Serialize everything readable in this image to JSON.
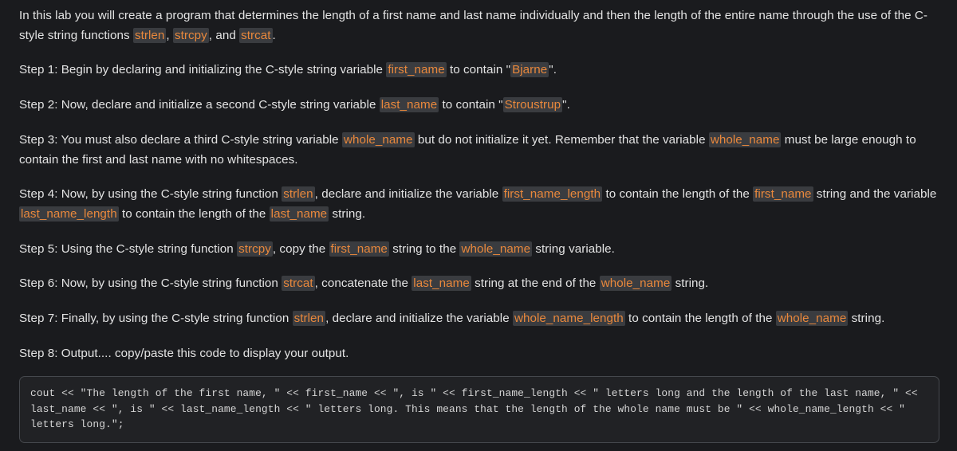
{
  "theme": {
    "background": "#1a1b1e",
    "text_color": "#e3e3e3",
    "inline_code_color": "#e9883c",
    "inline_code_background": "#3a3c40",
    "code_block_background": "#212225",
    "code_block_border": "#45484d",
    "code_block_text": "#d6d6d6"
  },
  "intro": {
    "t1": "In this lab you will create a program that determines the length of a first name and last name individually and then the length of the entire name through the use of the C-style string functions ",
    "c1": "strlen",
    "t2": ", ",
    "c2": "strcpy",
    "t3": ", and ",
    "c3": "strcat",
    "t4": "."
  },
  "step1": {
    "t1": "Step 1: Begin by declaring and initializing the C-style string variable ",
    "c1": "first_name",
    "t2": " to contain \"",
    "c2": "Bjarne",
    "t3": "\"."
  },
  "step2": {
    "t1": "Step 2: Now, declare and initialize a second C-style string variable ",
    "c1": "last_name",
    "t2": " to contain \"",
    "c2": "Stroustrup",
    "t3": "\"."
  },
  "step3": {
    "t1": "Step 3: You must also declare a third C-style string variable ",
    "c1": "whole_name",
    "t2": " but do not initialize it yet. Remember that the variable ",
    "c2": "whole_name",
    "t3": " must be large enough to contain the first and last name with no whitespaces."
  },
  "step4": {
    "t1": "Step 4: Now, by using the C-style string function ",
    "c1": "strlen",
    "t2": ", declare and initialize the variable ",
    "c2": "first_name_length",
    "t3": " to contain the length of the ",
    "c3": "first_name",
    "t4": " string and the variable ",
    "c4": "last_name_length",
    "t5": " to contain the length of the ",
    "c5": "last_name",
    "t6": " string."
  },
  "step5": {
    "t1": "Step 5: Using the C-style string function ",
    "c1": "strcpy",
    "t2": ", copy the ",
    "c2": "first_name",
    "t3": " string to the ",
    "c3": "whole_name",
    "t4": " string variable."
  },
  "step6": {
    "t1": "Step 6: Now, by using the C-style string function ",
    "c1": "strcat",
    "t2": ", concatenate the ",
    "c2": "last_name",
    "t3": " string at the end of the ",
    "c3": "whole_name",
    "t4": " string."
  },
  "step7": {
    "t1": "Step 7: Finally, by using the C-style string function ",
    "c1": "strlen",
    "t2": ", declare and initialize the variable ",
    "c2": "whole_name_length",
    "t3": " to contain the length of the ",
    "c3": "whole_name",
    "t4": " string."
  },
  "step8": {
    "t1": "Step 8: Output.... copy/paste this code to display your output."
  },
  "code_block": {
    "language": "cpp",
    "content": "cout << \"The length of the first name, \" << first_name << \", is \" << first_name_length << \" letters long and the length of the last name, \" << last_name << \", is \" << last_name_length << \" letters long. This means that the length of the whole name must be \" << whole_name_length << \" letters long.\";"
  }
}
